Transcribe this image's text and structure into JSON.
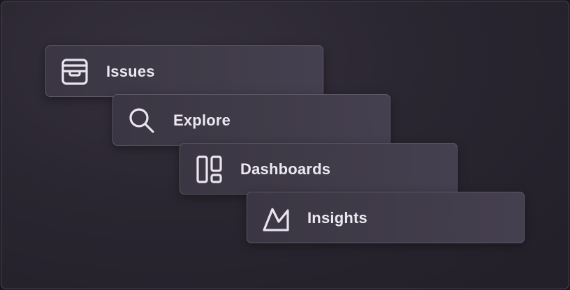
{
  "colors": {
    "background": "#2a2631",
    "card": "#413c49",
    "card_border": "#5e5867",
    "text": "#ece8f1",
    "icon": "#e9e2ef"
  },
  "nav": {
    "items": [
      {
        "label": "Issues",
        "icon": "inbox-tray-icon"
      },
      {
        "label": "Explore",
        "icon": "search-icon"
      },
      {
        "label": "Dashboards",
        "icon": "dashboard-layout-icon"
      },
      {
        "label": "Insights",
        "icon": "chart-trend-icon"
      }
    ]
  }
}
